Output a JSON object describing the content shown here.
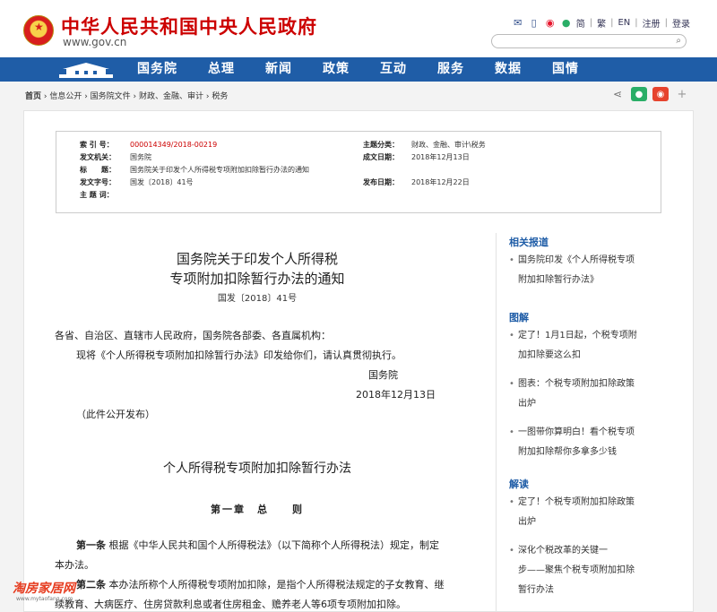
{
  "header": {
    "site_name": "中华人民共和国中央人民政府",
    "site_url": "www.gov.cn",
    "tools": [
      "简",
      "繁",
      "EN",
      "注册",
      "登录"
    ]
  },
  "nav": {
    "items": [
      "国务院",
      "总理",
      "新闻",
      "政策",
      "互动",
      "服务",
      "数据",
      "国情"
    ]
  },
  "breadcrumb": {
    "home": "首页",
    "path": "› 信息公开 › 国务院文件 › 财政、金融、审计 › 税务"
  },
  "info": {
    "index_label": "索 引 号：",
    "index_value": "000014349/2018-00219",
    "topic_label": "主题分类：",
    "topic_value": "财政、金融、审计\\税务",
    "issuer_label": "发文机关：",
    "issuer_value": "国务院",
    "written_label": "成文日期：",
    "written_value": "2018年12月13日",
    "title_label": "标　　题：",
    "title_value": "国务院关于印发个人所得税专项附加扣除暂行办法的通知",
    "docno_label": "发文字号：",
    "docno_value": "国发〔2018〕41号",
    "published_label": "发布日期：",
    "published_value": "2018年12月22日",
    "keywords_label": "主 题 词：",
    "keywords_value": ""
  },
  "article": {
    "title_line1": "国务院关于印发个人所得税",
    "title_line2": "专项附加扣除暂行办法的通知",
    "doc_number": "国发〔2018〕41号",
    "addressee": "各省、自治区、直辖市人民政府，国务院各部委、各直属机构：",
    "body": "现将《个人所得税专项附加扣除暂行办法》印发给你们，请认真贯彻执行。",
    "signer": "国务院",
    "date": "2018年12月13日",
    "note": "（此件公开发布）",
    "sub_title": "个人所得税专项附加扣除暂行办法",
    "chapter": "第一章　总　　则",
    "art1_label": "第一条",
    "art1_line1": "根据《中华人民共和国个人所得税法》（以下简称个人所得税法）规定，制定",
    "art1_line2": "本办法。",
    "art2_label": "第二条",
    "art2_line1": "本办法所称个人所得税专项附加扣除，是指个人所得税法规定的子女教育、继",
    "art2_line2": "续教育、大病医疗、住房贷款利息或者住房租金、赡养老人等6项专项附加扣除。"
  },
  "sidebar": {
    "related_head": "相关报道",
    "related": [
      {
        "line1": "国务院印发《个人所得税专项",
        "line2": "附加扣除暂行办法》"
      }
    ],
    "graphic_head": "图解",
    "graphic": [
      {
        "line1": "定了！1月1日起，个税专项附",
        "line2": "加扣除要这么扣"
      },
      {
        "line1": "图表：个税专项附加扣除政策",
        "line2": "出炉"
      },
      {
        "line1": "一图带你算明白！看个税专项",
        "line2": "附加扣除帮你多拿多少钱"
      }
    ],
    "interp_head": "解读",
    "interp": [
      {
        "line1": "定了！个税专项附加扣除政策",
        "line2": "出炉"
      },
      {
        "line1": "深化个税改革的关键一",
        "line2": "步——聚焦个税专项附加扣除",
        "line3": "暂行办法"
      }
    ]
  },
  "watermark": {
    "text": "淘房家居网",
    "url": "www.mytaofang.com"
  },
  "colors": {
    "nav_blue": "#1f5da7",
    "brand_red": "#cc0000"
  }
}
